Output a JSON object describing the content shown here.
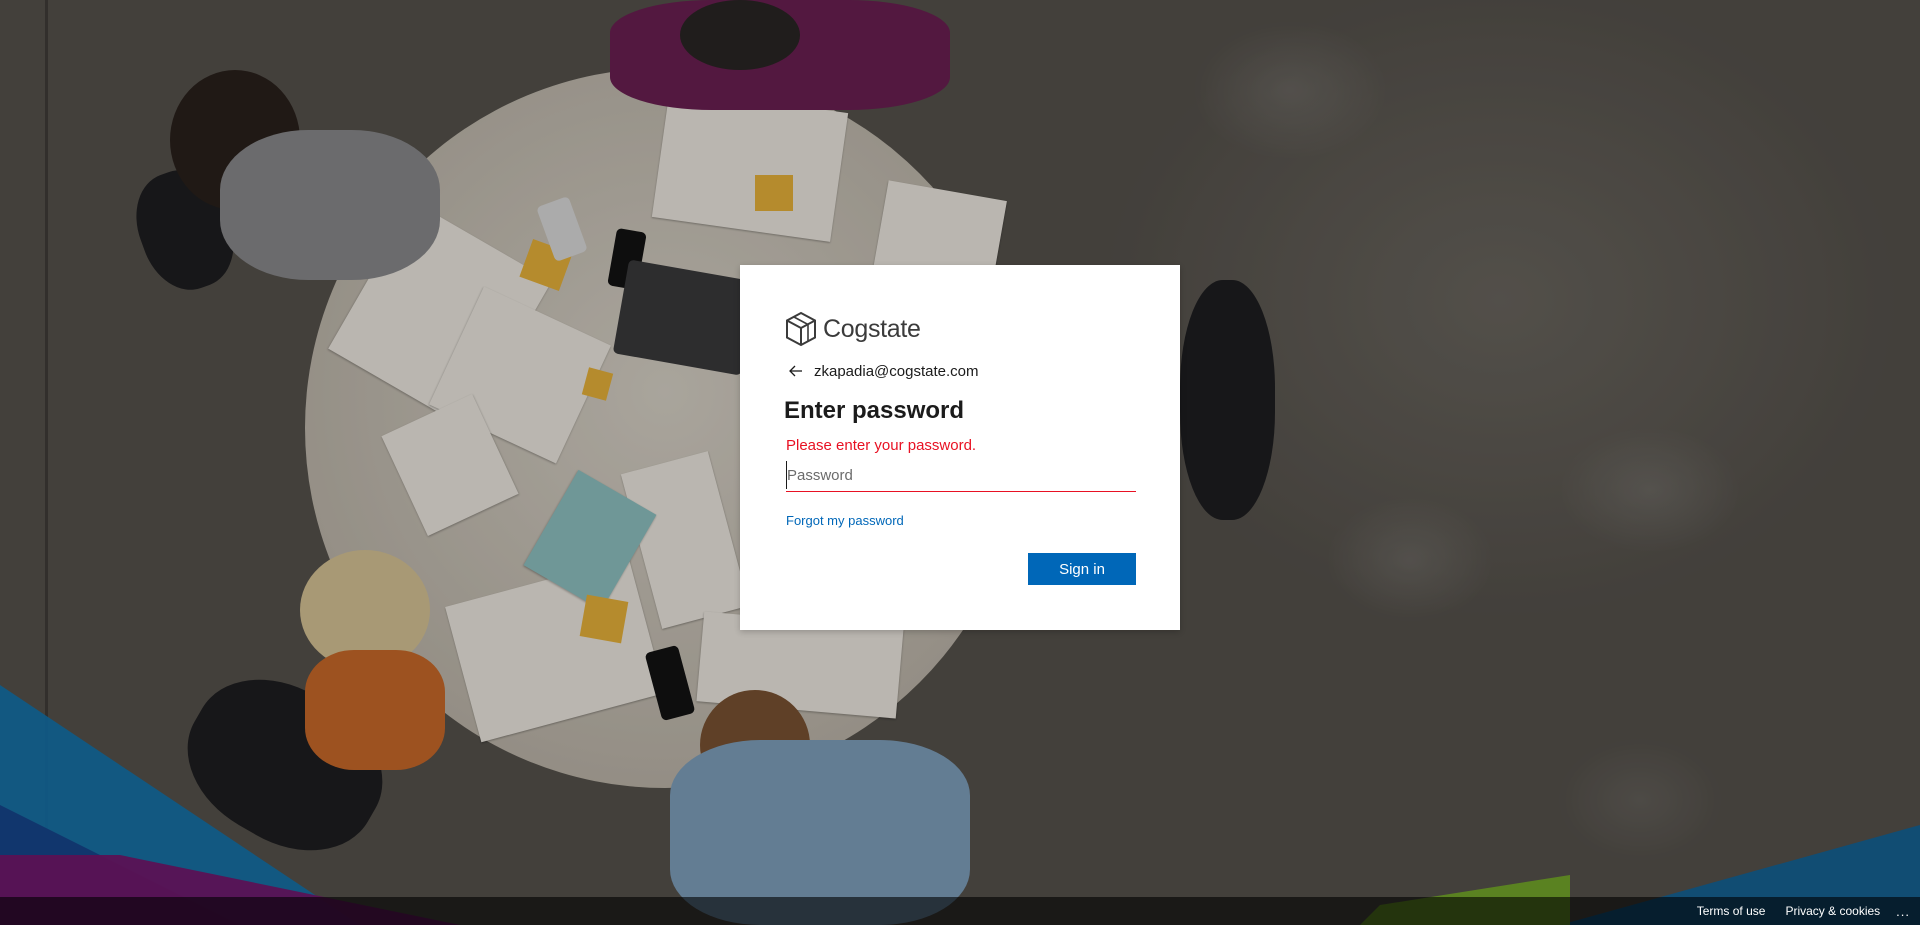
{
  "brand": {
    "name": "Cogstate",
    "logo_icon": "cube-icon"
  },
  "identity": {
    "email": "zkapadia@cogstate.com",
    "back_icon": "back-arrow-icon"
  },
  "form": {
    "title": "Enter password",
    "error": "Please enter your password.",
    "password_placeholder": "Password",
    "password_value": "",
    "forgot_label": "Forgot my password",
    "submit_label": "Sign in"
  },
  "footer": {
    "terms_label": "Terms of use",
    "privacy_label": "Privacy & cookies",
    "more_label": "..."
  },
  "colors": {
    "accent": "#0067b8",
    "error": "#e81123",
    "card_bg": "#ffffff"
  }
}
